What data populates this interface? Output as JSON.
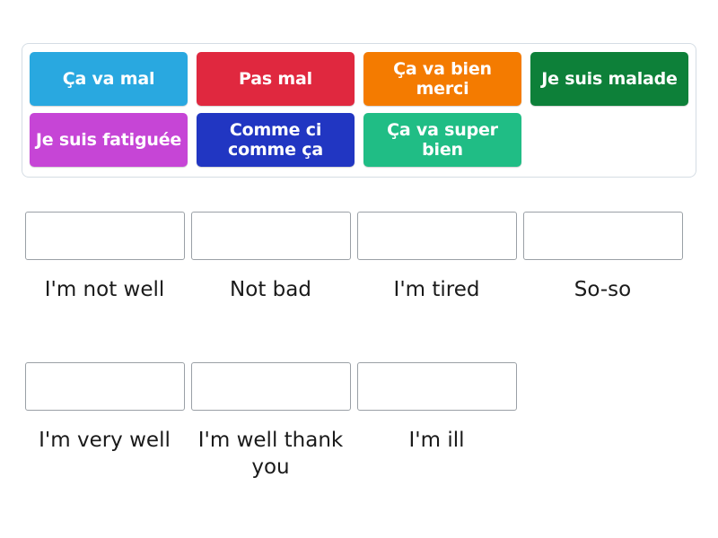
{
  "activity": {
    "type": "match-up-drag-and-drop",
    "tile_bank": {
      "name": "french-greetings-tile-bank",
      "tiles": [
        {
          "label": "Ça va mal",
          "color": "#29a8e0"
        },
        {
          "label": "Pas mal",
          "color": "#e0283f"
        },
        {
          "label": "Ça va bien merci",
          "color": "#f47b00"
        },
        {
          "label": "Je suis malade",
          "color": "#0d8039"
        },
        {
          "label": "Je suis fatiguée",
          "color": "#c645d6"
        },
        {
          "label": "Comme ci comme ça",
          "color": "#2136c2"
        },
        {
          "label": "Ça va super bien",
          "color": "#20bd85"
        }
      ]
    },
    "answers": {
      "name": "english-translation-targets",
      "placeholder": "",
      "items": [
        {
          "label": "I'm not well"
        },
        {
          "label": "Not bad"
        },
        {
          "label": "I'm tired"
        },
        {
          "label": "So-so"
        },
        {
          "label": "I'm very well"
        },
        {
          "label": "I'm well thank you"
        },
        {
          "label": "I'm ill"
        }
      ]
    }
  }
}
